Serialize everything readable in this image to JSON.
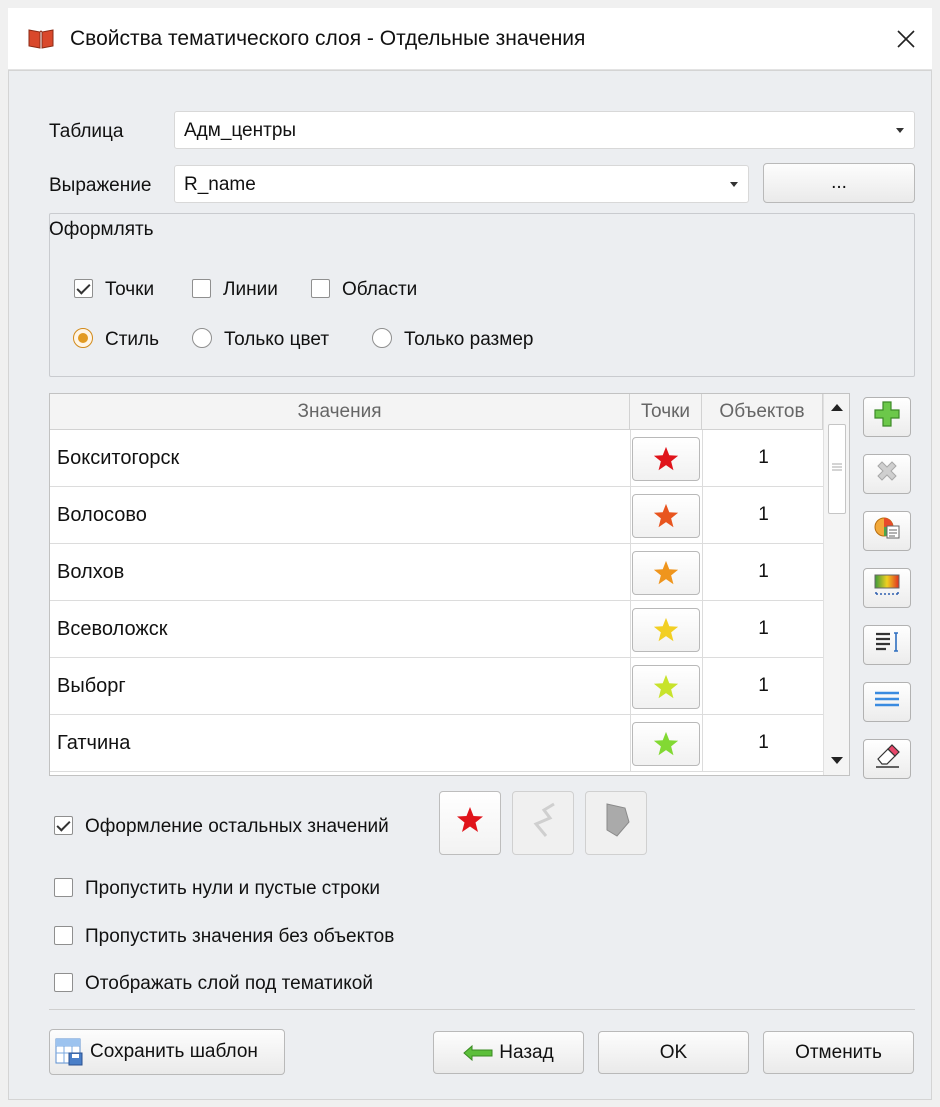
{
  "window": {
    "title": "Свойства тематического слоя - Отдельные значения",
    "icon": "book-icon",
    "close_icon": "close-icon"
  },
  "form": {
    "table_label": "Таблица",
    "table_value": "Адм_центры",
    "expression_label": "Выражение",
    "expression_value": "R_name",
    "expression_button": "..."
  },
  "design": {
    "group_label": "Оформлять",
    "checkboxes": [
      {
        "label": "Точки",
        "checked": true
      },
      {
        "label": "Линии",
        "checked": false
      },
      {
        "label": "Области",
        "checked": false
      }
    ],
    "radios": [
      {
        "label": "Стиль",
        "selected": true
      },
      {
        "label": "Только цвет",
        "selected": false
      },
      {
        "label": "Только размер",
        "selected": false
      }
    ]
  },
  "table": {
    "columns": [
      "Значения",
      "Точки",
      "Объектов"
    ],
    "rows": [
      {
        "value": "Бокситогорск",
        "star_color": "#e0141b",
        "count": "1"
      },
      {
        "value": "Волосово",
        "star_color": "#e8551f",
        "count": "1"
      },
      {
        "value": "Волхов",
        "star_color": "#ef951d",
        "count": "1"
      },
      {
        "value": "Всеволожск",
        "star_color": "#f2cf23",
        "count": "1"
      },
      {
        "value": "Выборг",
        "star_color": "#c8e32c",
        "count": "1"
      },
      {
        "value": "Гатчина",
        "star_color": "#82d933",
        "count": "1"
      }
    ]
  },
  "toolbar": [
    {
      "name": "add-value-icon",
      "disabled": false
    },
    {
      "name": "delete-value-icon",
      "disabled": true
    },
    {
      "name": "color-palette-icon",
      "disabled": false
    },
    {
      "name": "gradient-icon",
      "disabled": false
    },
    {
      "name": "sort-list-icon",
      "disabled": false
    },
    {
      "name": "lines-icon",
      "disabled": false
    },
    {
      "name": "eraser-icon",
      "disabled": false
    }
  ],
  "other_values": {
    "label": "Оформление остальных значений",
    "checked": true,
    "point_color": "#e0141b"
  },
  "options": [
    {
      "label": "Пропустить нули и пустые строки",
      "checked": false
    },
    {
      "label": "Пропустить значения без объектов",
      "checked": false
    },
    {
      "label": "Отображать слой под тематикой",
      "checked": false
    }
  ],
  "buttons": {
    "save_template": "Сохранить шаблон",
    "back": "Назад",
    "ok": "OK",
    "cancel": "Отменить"
  }
}
